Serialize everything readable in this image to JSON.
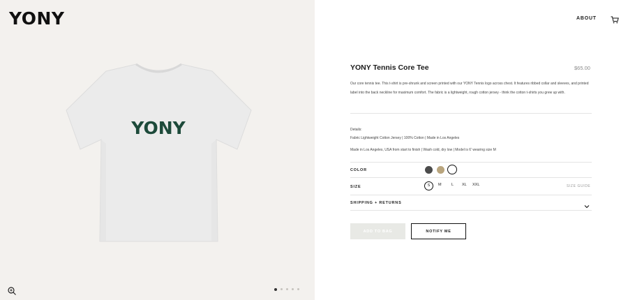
{
  "brand": {
    "logo": "YONY"
  },
  "nav": {
    "about": "ABOUT",
    "cart_icon": "cart-icon"
  },
  "gallery": {
    "zoom_icon": "zoom-in-icon",
    "tee_print": "YONY",
    "dots": 5,
    "active_dot": 0
  },
  "product": {
    "title": "YONY Tennis Core Tee",
    "price": "$65.00",
    "description": "Our core tennis tee. This t-shirt is pre-shrunk and screen printed with our YONY Tennis logo across chest. It features ribbed collar and sleeves, and printed label into the back neckline for maximum comfort. The fabric is a lightweight, rough cotton jersey - think the cotton t-shirts you grew up with.",
    "details_heading": "Details:",
    "details_line": "Fabric Lightweight Cotton Jersey  |  100% Cotton  |  Made in Los Angeles",
    "made_in": "Made in Los Angeles, USA from start to finish  |  Wash cold, dry low  |  Model is 6' wearing size M"
  },
  "options": {
    "color_label": "COLOR",
    "colors": [
      "#4b4b4b",
      "#b9a57e",
      "#ffffff"
    ],
    "size_label": "SIZE",
    "sizes": [
      "S",
      "M",
      "L",
      "XL",
      "XXL"
    ],
    "selected_size": "S",
    "size_guide": "SIZE GUIDE"
  },
  "shipping": {
    "label": "SHIPPING + RETURNS"
  },
  "actions": {
    "add_to_bag": "ADD TO BAG",
    "notify": "NOTIFY ME"
  }
}
